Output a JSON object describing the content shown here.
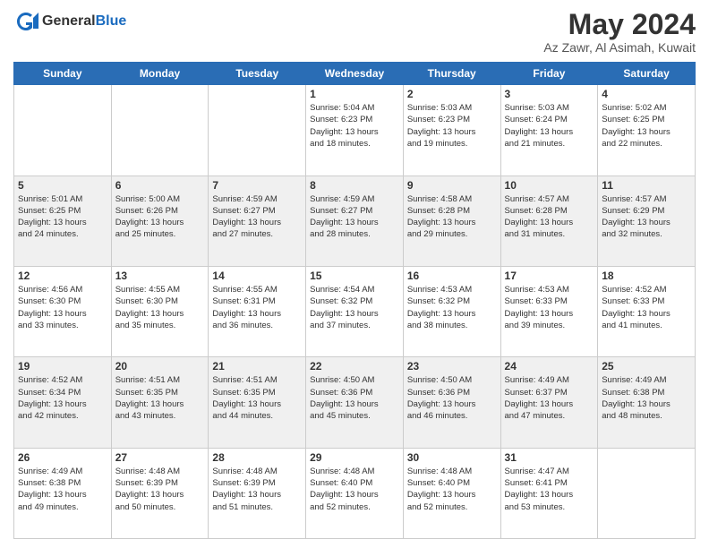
{
  "header": {
    "logo_line1": "General",
    "logo_line2": "Blue",
    "month_title": "May 2024",
    "location": "Az Zawr, Al Asimah, Kuwait"
  },
  "days_of_week": [
    "Sunday",
    "Monday",
    "Tuesday",
    "Wednesday",
    "Thursday",
    "Friday",
    "Saturday"
  ],
  "weeks": [
    {
      "shaded": false,
      "days": [
        {
          "num": "",
          "info": ""
        },
        {
          "num": "",
          "info": ""
        },
        {
          "num": "",
          "info": ""
        },
        {
          "num": "1",
          "info": "Sunrise: 5:04 AM\nSunset: 6:23 PM\nDaylight: 13 hours\nand 18 minutes."
        },
        {
          "num": "2",
          "info": "Sunrise: 5:03 AM\nSunset: 6:23 PM\nDaylight: 13 hours\nand 19 minutes."
        },
        {
          "num": "3",
          "info": "Sunrise: 5:03 AM\nSunset: 6:24 PM\nDaylight: 13 hours\nand 21 minutes."
        },
        {
          "num": "4",
          "info": "Sunrise: 5:02 AM\nSunset: 6:25 PM\nDaylight: 13 hours\nand 22 minutes."
        }
      ]
    },
    {
      "shaded": true,
      "days": [
        {
          "num": "5",
          "info": "Sunrise: 5:01 AM\nSunset: 6:25 PM\nDaylight: 13 hours\nand 24 minutes."
        },
        {
          "num": "6",
          "info": "Sunrise: 5:00 AM\nSunset: 6:26 PM\nDaylight: 13 hours\nand 25 minutes."
        },
        {
          "num": "7",
          "info": "Sunrise: 4:59 AM\nSunset: 6:27 PM\nDaylight: 13 hours\nand 27 minutes."
        },
        {
          "num": "8",
          "info": "Sunrise: 4:59 AM\nSunset: 6:27 PM\nDaylight: 13 hours\nand 28 minutes."
        },
        {
          "num": "9",
          "info": "Sunrise: 4:58 AM\nSunset: 6:28 PM\nDaylight: 13 hours\nand 29 minutes."
        },
        {
          "num": "10",
          "info": "Sunrise: 4:57 AM\nSunset: 6:28 PM\nDaylight: 13 hours\nand 31 minutes."
        },
        {
          "num": "11",
          "info": "Sunrise: 4:57 AM\nSunset: 6:29 PM\nDaylight: 13 hours\nand 32 minutes."
        }
      ]
    },
    {
      "shaded": false,
      "days": [
        {
          "num": "12",
          "info": "Sunrise: 4:56 AM\nSunset: 6:30 PM\nDaylight: 13 hours\nand 33 minutes."
        },
        {
          "num": "13",
          "info": "Sunrise: 4:55 AM\nSunset: 6:30 PM\nDaylight: 13 hours\nand 35 minutes."
        },
        {
          "num": "14",
          "info": "Sunrise: 4:55 AM\nSunset: 6:31 PM\nDaylight: 13 hours\nand 36 minutes."
        },
        {
          "num": "15",
          "info": "Sunrise: 4:54 AM\nSunset: 6:32 PM\nDaylight: 13 hours\nand 37 minutes."
        },
        {
          "num": "16",
          "info": "Sunrise: 4:53 AM\nSunset: 6:32 PM\nDaylight: 13 hours\nand 38 minutes."
        },
        {
          "num": "17",
          "info": "Sunrise: 4:53 AM\nSunset: 6:33 PM\nDaylight: 13 hours\nand 39 minutes."
        },
        {
          "num": "18",
          "info": "Sunrise: 4:52 AM\nSunset: 6:33 PM\nDaylight: 13 hours\nand 41 minutes."
        }
      ]
    },
    {
      "shaded": true,
      "days": [
        {
          "num": "19",
          "info": "Sunrise: 4:52 AM\nSunset: 6:34 PM\nDaylight: 13 hours\nand 42 minutes."
        },
        {
          "num": "20",
          "info": "Sunrise: 4:51 AM\nSunset: 6:35 PM\nDaylight: 13 hours\nand 43 minutes."
        },
        {
          "num": "21",
          "info": "Sunrise: 4:51 AM\nSunset: 6:35 PM\nDaylight: 13 hours\nand 44 minutes."
        },
        {
          "num": "22",
          "info": "Sunrise: 4:50 AM\nSunset: 6:36 PM\nDaylight: 13 hours\nand 45 minutes."
        },
        {
          "num": "23",
          "info": "Sunrise: 4:50 AM\nSunset: 6:36 PM\nDaylight: 13 hours\nand 46 minutes."
        },
        {
          "num": "24",
          "info": "Sunrise: 4:49 AM\nSunset: 6:37 PM\nDaylight: 13 hours\nand 47 minutes."
        },
        {
          "num": "25",
          "info": "Sunrise: 4:49 AM\nSunset: 6:38 PM\nDaylight: 13 hours\nand 48 minutes."
        }
      ]
    },
    {
      "shaded": false,
      "days": [
        {
          "num": "26",
          "info": "Sunrise: 4:49 AM\nSunset: 6:38 PM\nDaylight: 13 hours\nand 49 minutes."
        },
        {
          "num": "27",
          "info": "Sunrise: 4:48 AM\nSunset: 6:39 PM\nDaylight: 13 hours\nand 50 minutes."
        },
        {
          "num": "28",
          "info": "Sunrise: 4:48 AM\nSunset: 6:39 PM\nDaylight: 13 hours\nand 51 minutes."
        },
        {
          "num": "29",
          "info": "Sunrise: 4:48 AM\nSunset: 6:40 PM\nDaylight: 13 hours\nand 52 minutes."
        },
        {
          "num": "30",
          "info": "Sunrise: 4:48 AM\nSunset: 6:40 PM\nDaylight: 13 hours\nand 52 minutes."
        },
        {
          "num": "31",
          "info": "Sunrise: 4:47 AM\nSunset: 6:41 PM\nDaylight: 13 hours\nand 53 minutes."
        },
        {
          "num": "",
          "info": ""
        }
      ]
    }
  ]
}
